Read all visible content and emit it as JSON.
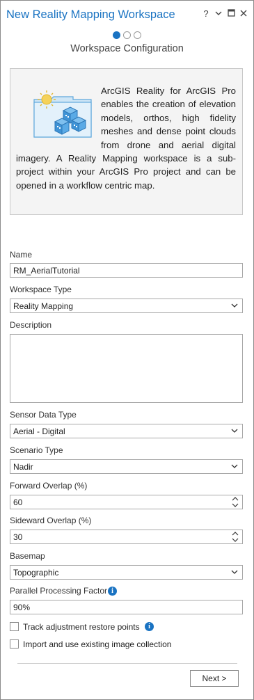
{
  "window": {
    "title": "New Reality Mapping Workspace",
    "help_glyph": "?",
    "controls": [
      "chevron-down-icon",
      "maximize-icon",
      "close-icon"
    ]
  },
  "wizard": {
    "total_steps": 3,
    "current_step": 1,
    "step_title": "Workspace Configuration"
  },
  "info": {
    "text": "ArcGIS Reality for ArcGIS Pro enables the creation of elevation models, orthos, high fidelity meshes and dense point clouds from drone and aerial digital imagery. A Reality Mapping workspace is a sub-project within your ArcGIS Pro project and can be opened in a workflow centric map.",
    "illustration": "folder-with-sun-and-cubes-illustration"
  },
  "form": {
    "name": {
      "label": "Name",
      "value": "RM_AerialTutorial"
    },
    "workspace_type": {
      "label": "Workspace Type",
      "value": "Reality Mapping"
    },
    "description": {
      "label": "Description",
      "value": ""
    },
    "sensor_data_type": {
      "label": "Sensor Data Type",
      "value": "Aerial - Digital"
    },
    "scenario_type": {
      "label": "Scenario Type",
      "value": "Nadir"
    },
    "forward_overlap": {
      "label": "Forward Overlap (%)",
      "value": "60"
    },
    "sideward_overlap": {
      "label": "Sideward Overlap (%)",
      "value": "30"
    },
    "basemap": {
      "label": "Basemap",
      "value": "Topographic"
    },
    "parallel_processing": {
      "label": "Parallel Processing Factor",
      "value": "90%"
    },
    "track_adjustment": {
      "label": "Track adjustment restore points",
      "checked": false
    },
    "import_collection": {
      "label": "Import and use existing image collection",
      "checked": false
    }
  },
  "footer": {
    "next_label": "Next >"
  },
  "colors": {
    "accent": "#1a73c2",
    "info_bg": "#f4f4f4",
    "border": "#a8a8a8"
  }
}
